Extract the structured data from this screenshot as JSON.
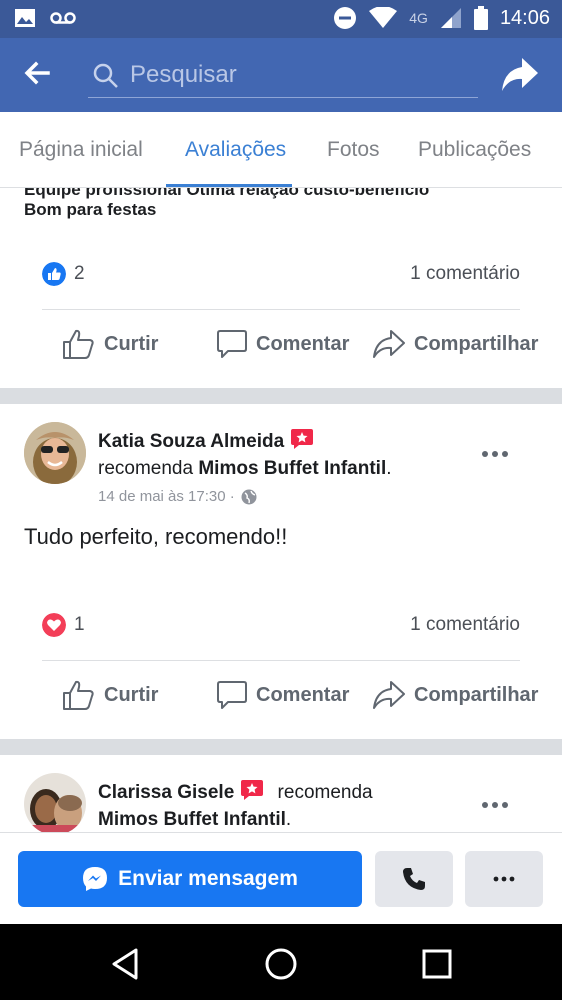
{
  "status_bar": {
    "network": "4G",
    "time": "14:06",
    "icons": [
      "gallery-icon",
      "voicemail-icon",
      "do-not-disturb-icon",
      "wifi-icon",
      "signal-icon",
      "battery-icon"
    ]
  },
  "app_bar": {
    "search_placeholder": "Pesquisar",
    "back_icon": "arrow-left-icon",
    "share_icon": "share-arrow-icon",
    "bg_color": "#4267b2"
  },
  "tabs": [
    {
      "label": "Página inicial",
      "active": false
    },
    {
      "label": "Avaliações",
      "active": true
    },
    {
      "label": "Fotos",
      "active": false
    },
    {
      "label": "Publicações",
      "active": false
    }
  ],
  "post1": {
    "tags_clipped": "Equipe profissional    Ótima relação custo-benefício",
    "tag_visible": "Bom para festas",
    "reaction_type": "like",
    "reaction_count": "2",
    "comments": "1 comentário"
  },
  "actions": {
    "like": "Curtir",
    "comment": "Comentar",
    "share": "Compartilhar"
  },
  "post2": {
    "author": "Katia Souza Almeida",
    "recommends_prefix": "recomenda",
    "page": "Mimos Buffet Infantil",
    "period": ".",
    "date": "14 de mai às 17:30 ·",
    "text": "Tudo perfeito, recomendo!!",
    "reaction_type": "love",
    "reaction_count": "1",
    "comments": "1 comentário"
  },
  "post3": {
    "author": "Clarissa Gisele",
    "recommends_prefix": "recomenda",
    "page": "Mimos Buffet Infantil",
    "period": "."
  },
  "bottom_bar": {
    "message_label": "Enviar mensagem",
    "primary_color": "#1877f2"
  },
  "nav_bar": {
    "icons": [
      "back-triangle-icon",
      "home-circle-icon",
      "recents-square-icon"
    ]
  }
}
